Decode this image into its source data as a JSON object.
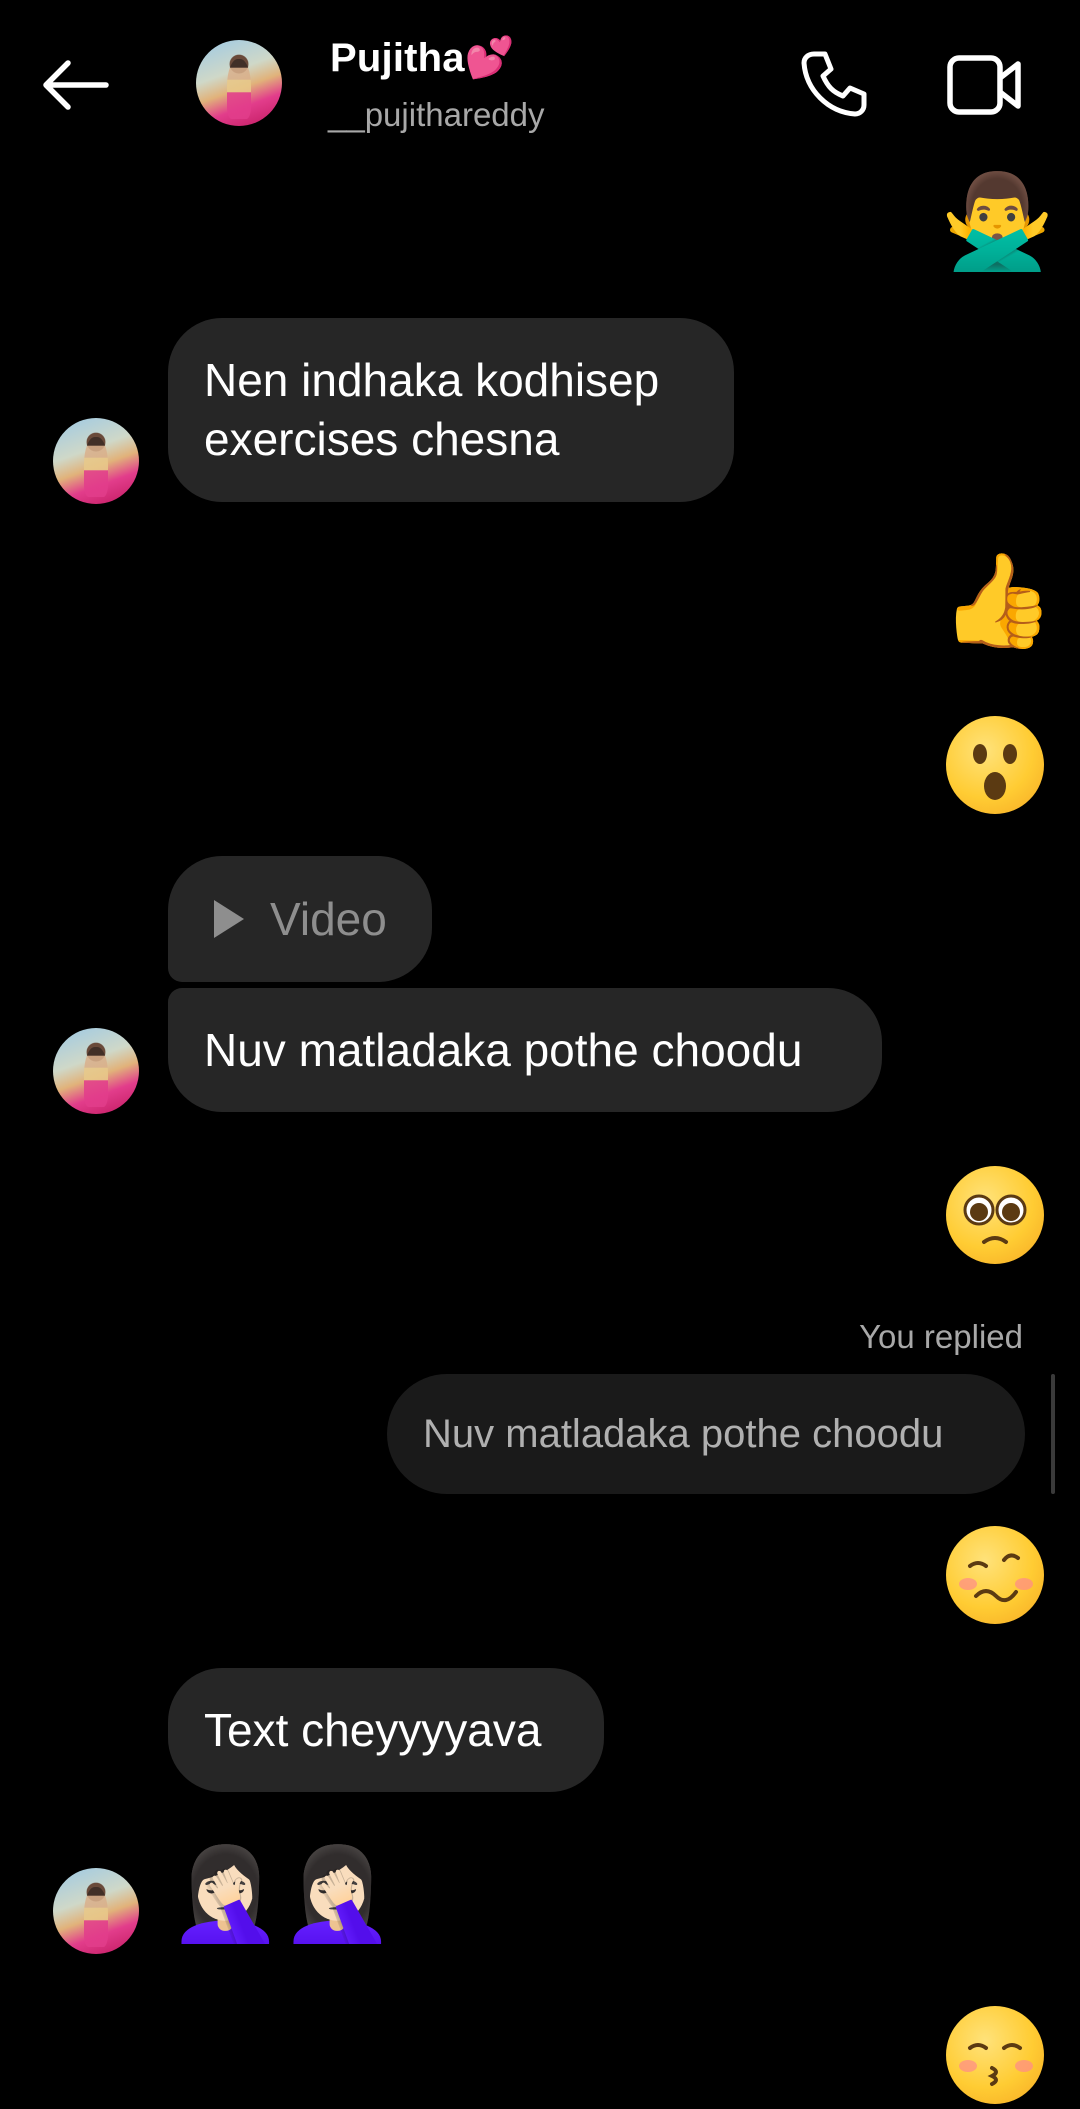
{
  "header": {
    "contact_name": "Pujitha💕",
    "username": "__pujithareddy",
    "back_icon": "arrow-left-icon",
    "call_icon": "phone-icon",
    "video_call_icon": "video-camera-icon"
  },
  "messages": {
    "m1_sent_emoji": "🙅‍♂️",
    "m2_received_text": "Nen indhaka kodhisep exercises chesna",
    "m3_sent_emoji": "👍",
    "m4_sent_emoji": "😮",
    "m5_video_label": "Video",
    "m6_received_text": "Nuv matladaka pothe choodu",
    "m7_sent_emoji": "🥺",
    "reply_label": "You replied",
    "replied_text": "Nuv matladaka pothe choodu",
    "m8_sent_emoji": "🥴",
    "m9_received_text": "Text cheyyyyava",
    "m10_received_emojis": [
      "🤦🏻‍♀️",
      "🤦🏻‍♀️"
    ],
    "m11_sent_emoji": "😚"
  },
  "colors": {
    "background": "#000000",
    "bubble": "#262626",
    "secondary_text": "#a8a8a8"
  }
}
